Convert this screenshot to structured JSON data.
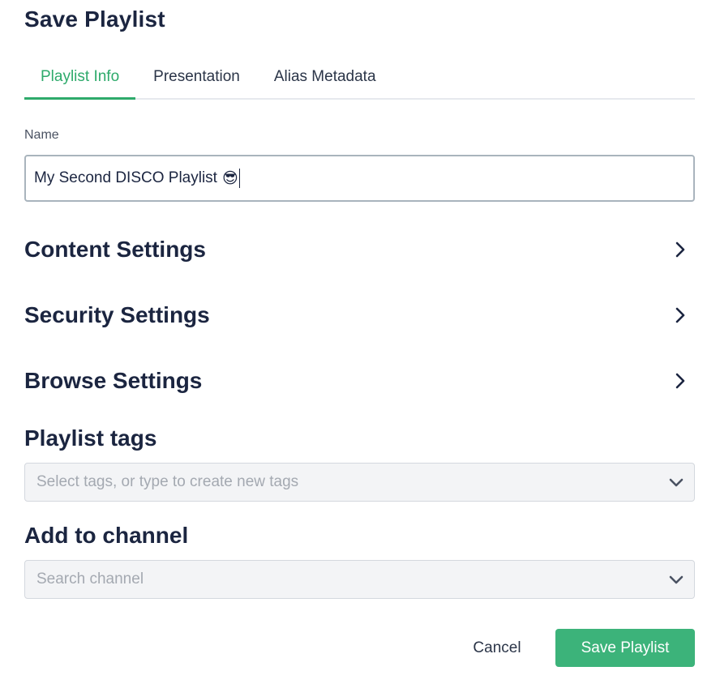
{
  "dialog": {
    "title": "Save Playlist"
  },
  "tabs": [
    {
      "label": "Playlist Info",
      "active": true
    },
    {
      "label": "Presentation",
      "active": false
    },
    {
      "label": "Alias Metadata",
      "active": false
    }
  ],
  "name_field": {
    "label": "Name",
    "value": "My Second DISCO Playlist",
    "emoji": "😎"
  },
  "sections": [
    {
      "title": "Content Settings",
      "icon": "chevron-right-icon"
    },
    {
      "title": "Security Settings",
      "icon": "chevron-right-icon"
    },
    {
      "title": "Browse Settings",
      "icon": "chevron-right-icon"
    }
  ],
  "playlist_tags": {
    "heading": "Playlist tags",
    "placeholder": "Select tags, or type to create new tags",
    "icon": "chevron-down-icon"
  },
  "add_to_channel": {
    "heading": "Add to channel",
    "placeholder": "Search channel",
    "icon": "chevron-down-icon"
  },
  "footer": {
    "cancel_label": "Cancel",
    "save_label": "Save Playlist"
  },
  "colors": {
    "accent": "#2eaa6b",
    "primary_button": "#3cb37a",
    "heading_text": "#1b2540",
    "input_border": "#a9b4bd",
    "select_bg": "#f3f4f6",
    "placeholder": "#a4a9b1"
  }
}
